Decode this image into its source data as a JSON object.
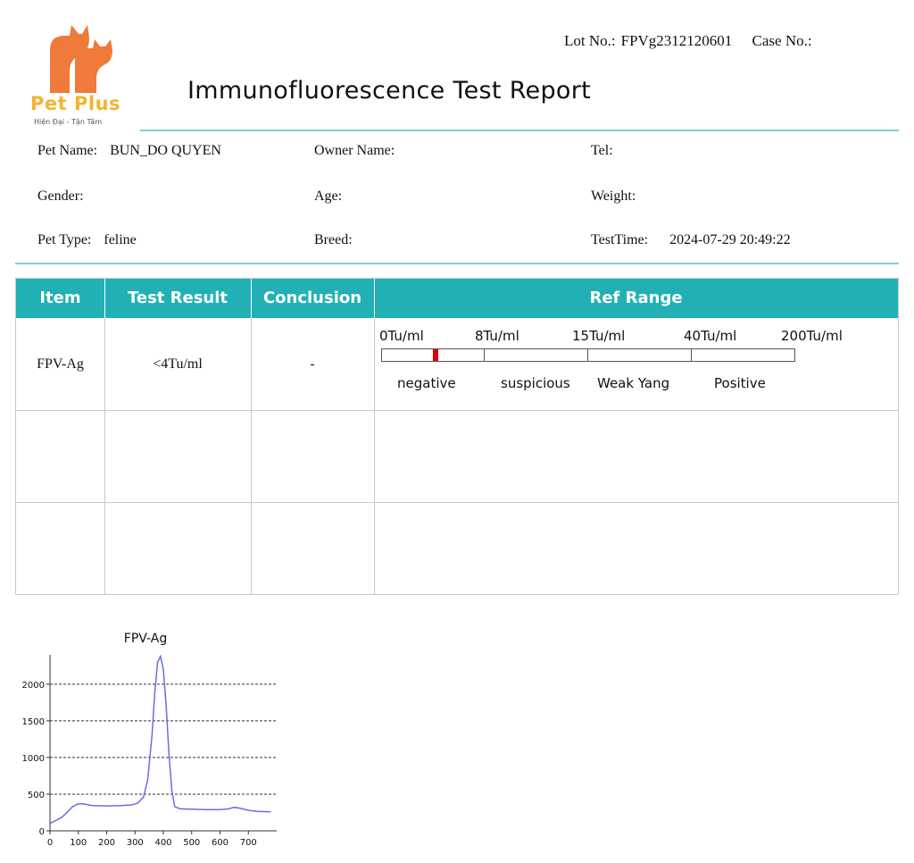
{
  "logo": {
    "name": "Pet Plus",
    "tagline": "Hiện Đại - Tận Tâm",
    "accent": "#f07a3a"
  },
  "header": {
    "lot_label": "Lot No.:",
    "lot_value": "FPVg2312120601",
    "case_label": "Case No.:",
    "title": "Immunofluorescence Test Report"
  },
  "info": {
    "pet_name_label": "Pet Name:",
    "pet_name": "BUN_DO QUYEN",
    "owner_label": "Owner Name:",
    "tel_label": "Tel:",
    "gender_label": "Gender:",
    "age_label": "Age:",
    "weight_label": "Weight:",
    "pet_type_label": "Pet Type:",
    "pet_type": "feline",
    "breed_label": "Breed:",
    "test_time_label": "TestTime:",
    "test_time": "2024-07-29 20:49:22"
  },
  "table": {
    "headers": [
      "Item",
      "Test Result",
      "Conclusion",
      "Ref Range"
    ],
    "header_color": "#21b1b5",
    "rows": [
      {
        "item": "FPV-Ag",
        "result": "<4Tu/ml",
        "conclusion": "-"
      }
    ],
    "ref_range": {
      "ticks": [
        "0Tu/ml",
        "8Tu/ml",
        "15Tu/ml",
        "40Tu/ml",
        "200Tu/ml"
      ],
      "zones": [
        "negative",
        "suspicious",
        "Weak Yang",
        "Positive"
      ],
      "marker_color": "#e00000"
    }
  },
  "chart_data": {
    "type": "line",
    "title": "FPV-Ag",
    "xlabel": "",
    "ylabel": "",
    "xlim": [
      0,
      800
    ],
    "ylim": [
      0,
      2400
    ],
    "xticks": [
      0,
      100,
      200,
      300,
      400,
      500,
      600,
      700
    ],
    "yticks": [
      0,
      500,
      1000,
      1500,
      2000
    ],
    "grid": "dashed horizontal",
    "line_color": "#6b6bee",
    "x": [
      0,
      20,
      40,
      60,
      80,
      100,
      120,
      150,
      200,
      250,
      290,
      310,
      330,
      345,
      360,
      370,
      380,
      390,
      400,
      410,
      420,
      430,
      440,
      460,
      500,
      550,
      600,
      630,
      650,
      670,
      700,
      730,
      780
    ],
    "y": [
      100,
      140,
      180,
      250,
      330,
      370,
      365,
      345,
      340,
      345,
      355,
      380,
      460,
      700,
      1300,
      1900,
      2300,
      2380,
      2200,
      1700,
      1050,
      550,
      330,
      300,
      295,
      290,
      290,
      300,
      320,
      310,
      280,
      265,
      260
    ]
  }
}
